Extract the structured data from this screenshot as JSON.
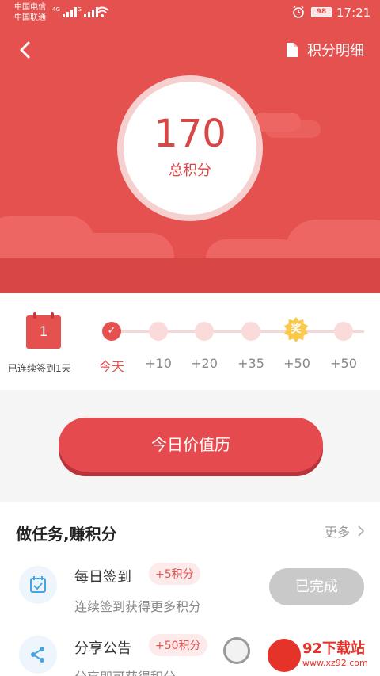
{
  "status_bar": {
    "carrier1": "中国电信",
    "carrier2": "中国联通",
    "net1": "4G",
    "net2": "3G",
    "battery": "98",
    "time": "17:21"
  },
  "header": {
    "back_icon": "chevron-left-icon",
    "detail_icon": "document-icon",
    "detail_label": "积分明细",
    "score": "170",
    "score_label": "总积分"
  },
  "signin": {
    "streak_day": "1",
    "streak_label": "已连续签到1天",
    "prize_label": "奖",
    "days": [
      {
        "label": "今天",
        "checked": true
      },
      {
        "label": "+10",
        "checked": false
      },
      {
        "label": "+20",
        "checked": false
      },
      {
        "label": "+35",
        "checked": false
      },
      {
        "label": "+50",
        "checked": false,
        "prize": true
      },
      {
        "label": "+50",
        "checked": false
      }
    ]
  },
  "action": {
    "value_button": "今日价值历"
  },
  "tasks": {
    "title": "做任务,赚积分",
    "more": "更多",
    "items": [
      {
        "title": "每日签到",
        "badge": "+5积分",
        "desc": "连续签到获得更多积分",
        "status": "已完成",
        "icon": "calendar-check-icon"
      },
      {
        "title": "分享公告",
        "badge": "+50积分",
        "desc": "分享即可获得积分",
        "icon": "share-icon"
      }
    ]
  },
  "watermark": {
    "name": "92下载站",
    "url": "www.xz92.com"
  },
  "colors": {
    "primary": "#e5514f",
    "button": "#e44a4e",
    "done": "#c9c9c9"
  }
}
